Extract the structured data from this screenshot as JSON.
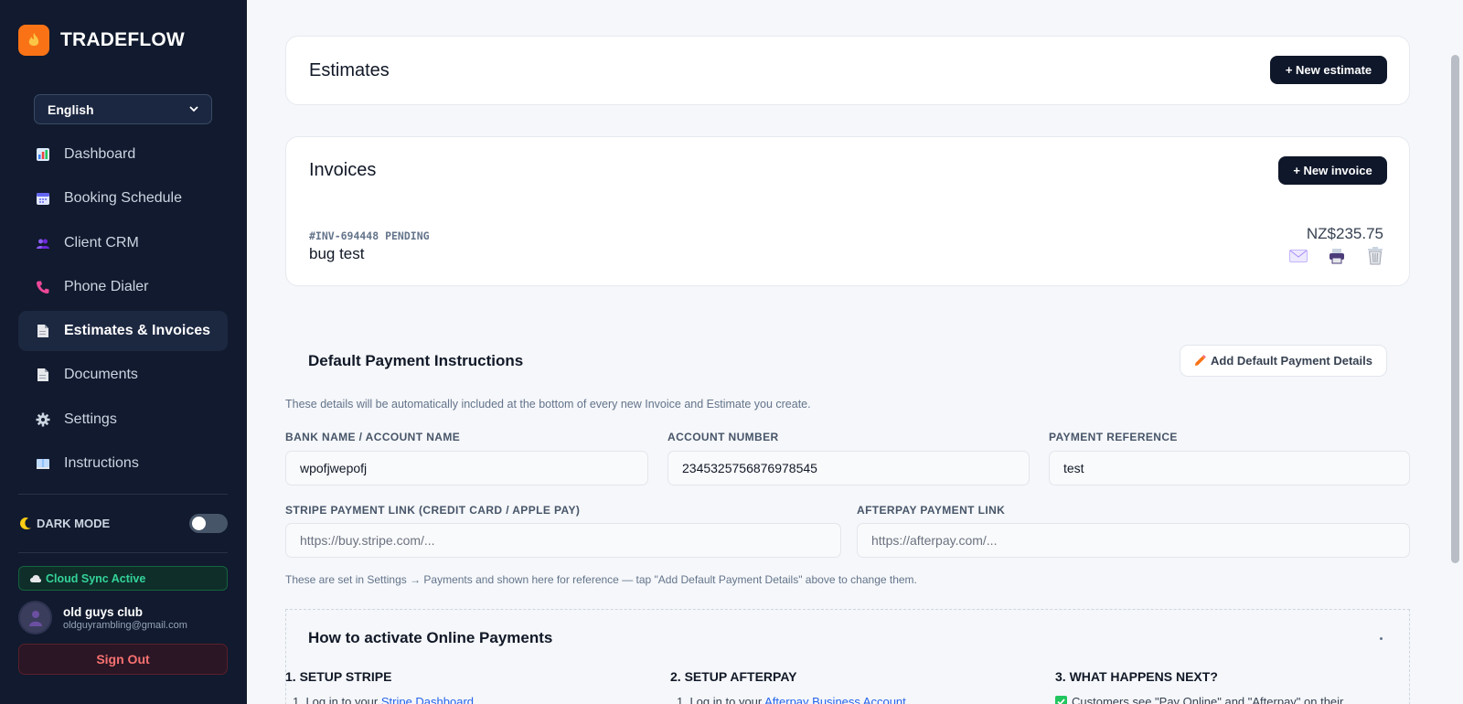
{
  "brand": {
    "name": "TRADEFLOW"
  },
  "language": {
    "selected": "English"
  },
  "nav": [
    {
      "label": "Dashboard",
      "icon": "bar-chart-icon"
    },
    {
      "label": "Booking Schedule",
      "icon": "calendar-icon"
    },
    {
      "label": "Client CRM",
      "icon": "users-icon"
    },
    {
      "label": "Phone Dialer",
      "icon": "phone-icon"
    },
    {
      "label": "Estimates & Invoices",
      "icon": "document-icon",
      "active": true
    },
    {
      "label": "Documents",
      "icon": "document-icon"
    },
    {
      "label": "Settings",
      "icon": "gear-icon"
    },
    {
      "label": "Instructions",
      "icon": "book-icon"
    }
  ],
  "dark_mode": {
    "label": "DARK MODE",
    "enabled": false
  },
  "sync": {
    "label": "Cloud Sync Active"
  },
  "user": {
    "name": "old guys club",
    "email": "oldguyrambling@gmail.com"
  },
  "sign_out": "Sign Out",
  "estimates": {
    "title": "Estimates",
    "new_button": "+ New estimate"
  },
  "invoices": {
    "title": "Invoices",
    "new_button": "+ New invoice",
    "items": [
      {
        "meta": "#INV-694448 PENDING",
        "client": "bug test",
        "amount": "NZ$235.75"
      }
    ]
  },
  "payment": {
    "title": "Default Payment Instructions",
    "add_button": "Add Default Payment Details",
    "helper": "These details will be automatically included at the bottom of every new Invoice and Estimate you create.",
    "bank_label": "BANK NAME / ACCOUNT NAME",
    "bank_value": "wpofjwepofj",
    "account_label": "ACCOUNT NUMBER",
    "account_value": "2345325756876978545",
    "reference_label": "PAYMENT REFERENCE",
    "reference_value": "test",
    "stripe_label": "STRIPE PAYMENT LINK (CREDIT CARD / APPLE PAY)",
    "stripe_placeholder": "https://buy.stripe.com/...",
    "afterpay_label": "AFTERPAY PAYMENT LINK",
    "afterpay_placeholder": "https://afterpay.com/...",
    "note": "These are set in Settings → Payments and shown here for reference — tap \"Add Default Payment Details\" above to change them."
  },
  "activate": {
    "title": "How to activate Online Payments",
    "steps": [
      {
        "title": "1. SETUP STRIPE",
        "prefix": "1. Log in to your ",
        "link": "Stripe Dashboard"
      },
      {
        "title": "2. SETUP AFTERPAY",
        "prefix": "1. Log in to your ",
        "link": "Afterpay Business Account"
      },
      {
        "title": "3. WHAT HAPPENS NEXT?",
        "prefix": "Customers see \"Pay Online\" and \"Afterpay\" on their"
      }
    ]
  },
  "colors": {
    "accent": "#f97316",
    "sidebar": "#111a2e",
    "button_dark": "#0f172a",
    "success": "#34d399",
    "danger": "#f87171"
  }
}
